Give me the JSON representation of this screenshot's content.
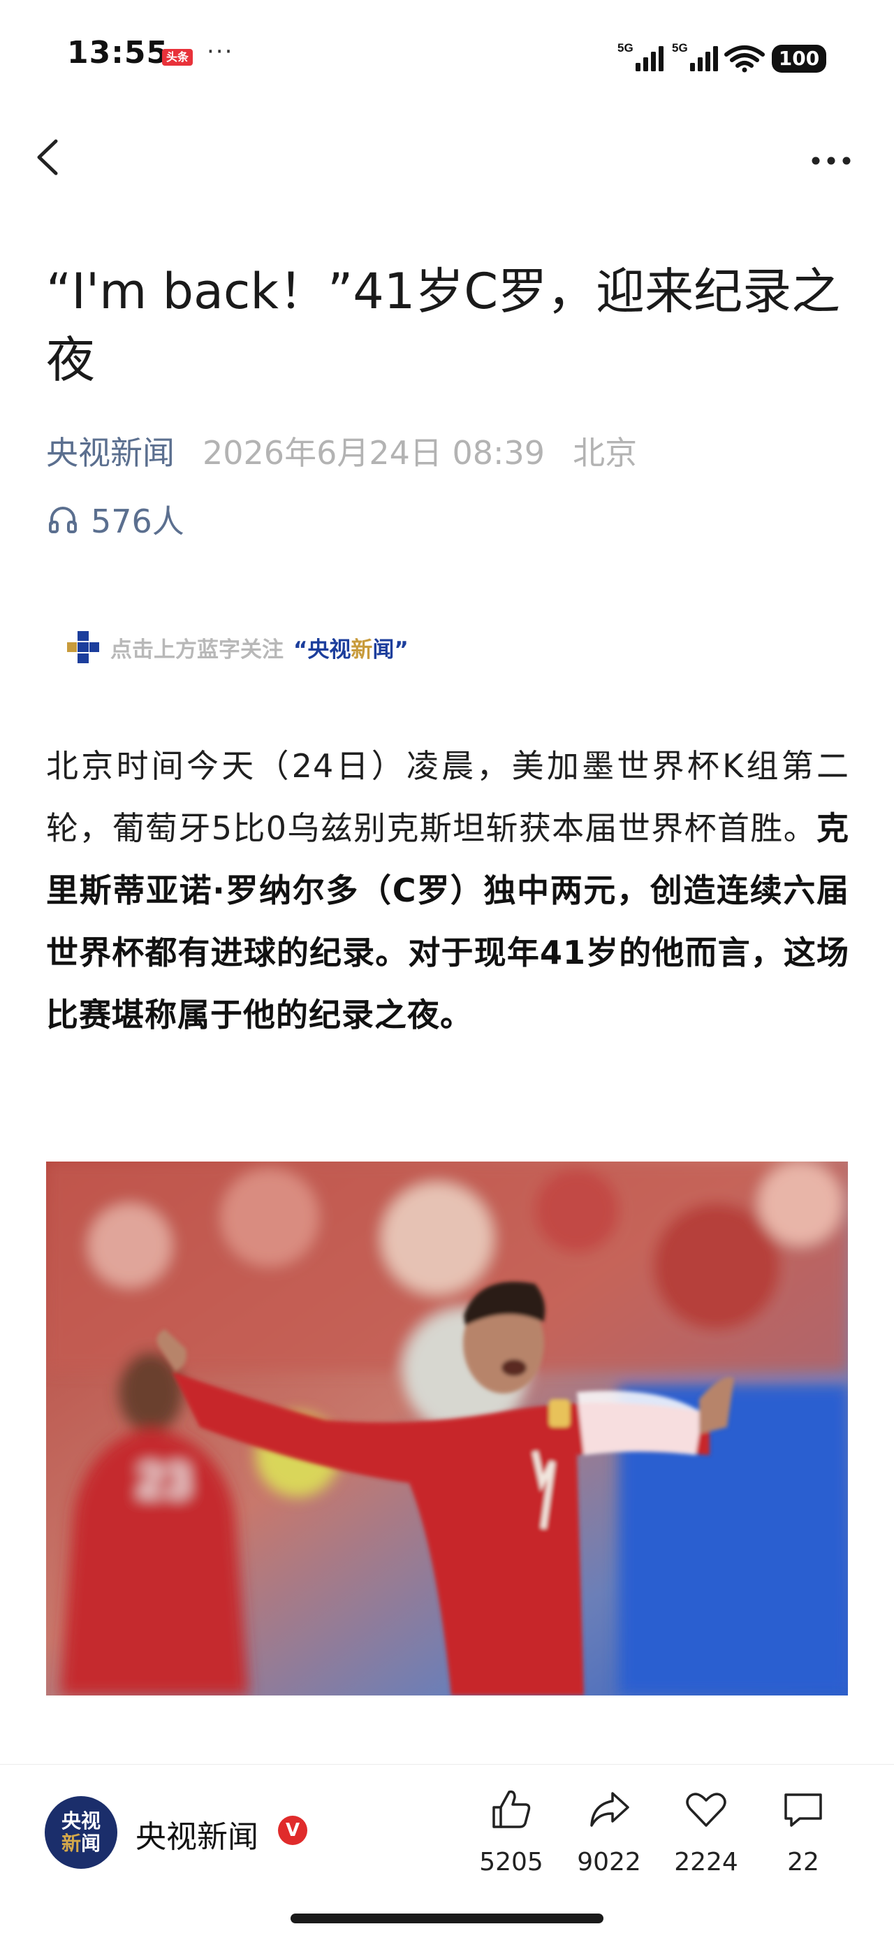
{
  "status_bar": {
    "time": "13:55",
    "app_badge": "头条",
    "dots": "···",
    "signal_1": "5G",
    "signal_2": "5G",
    "battery": "100"
  },
  "article": {
    "title": "“I'm back！”41岁C罗，迎来纪录之夜",
    "source": "央视新闻",
    "date": "2026年6月24日 08:39",
    "location": "北京",
    "listeners": "576人",
    "follow_prompt": "点击上方蓝字关注",
    "follow_brand_open": "“",
    "follow_brand_a": "央视",
    "follow_brand_b": "新",
    "follow_brand_c": "闻",
    "follow_brand_close": "”",
    "body_plain": "北京时间今天（24日）凌晨，美加墨世界杯K组第二轮，葡萄牙5比0乌兹别克斯坦斩获本届世界杯首胜。",
    "body_bold": "克里斯蒂亚诺·罗纳尔多（C罗）独中两元，创造连续六届世界杯都有进球的纪录。对于现年41岁的他而言，这场比赛堪称属于他的纪录之夜。",
    "photo_alt": "7"
  },
  "bottom_bar": {
    "avatar_line1": "央视",
    "avatar_line2_a": "新",
    "avatar_line2_b": "闻",
    "channel_name": "央视新闻",
    "verified": "V",
    "like_count": "5205",
    "share_count": "9022",
    "favorite_count": "2224",
    "comment_count": "22"
  },
  "colors": {
    "source_blue": "#5b6f8f",
    "meta_gray": "#b3b3b3",
    "brand_navy": "#1b2e6b",
    "verified_red": "#e02b2b"
  },
  "icons": [
    "back-icon",
    "more-icon",
    "headphone-icon",
    "thumbs-up-icon",
    "share-icon",
    "heart-icon",
    "comment-icon"
  ]
}
